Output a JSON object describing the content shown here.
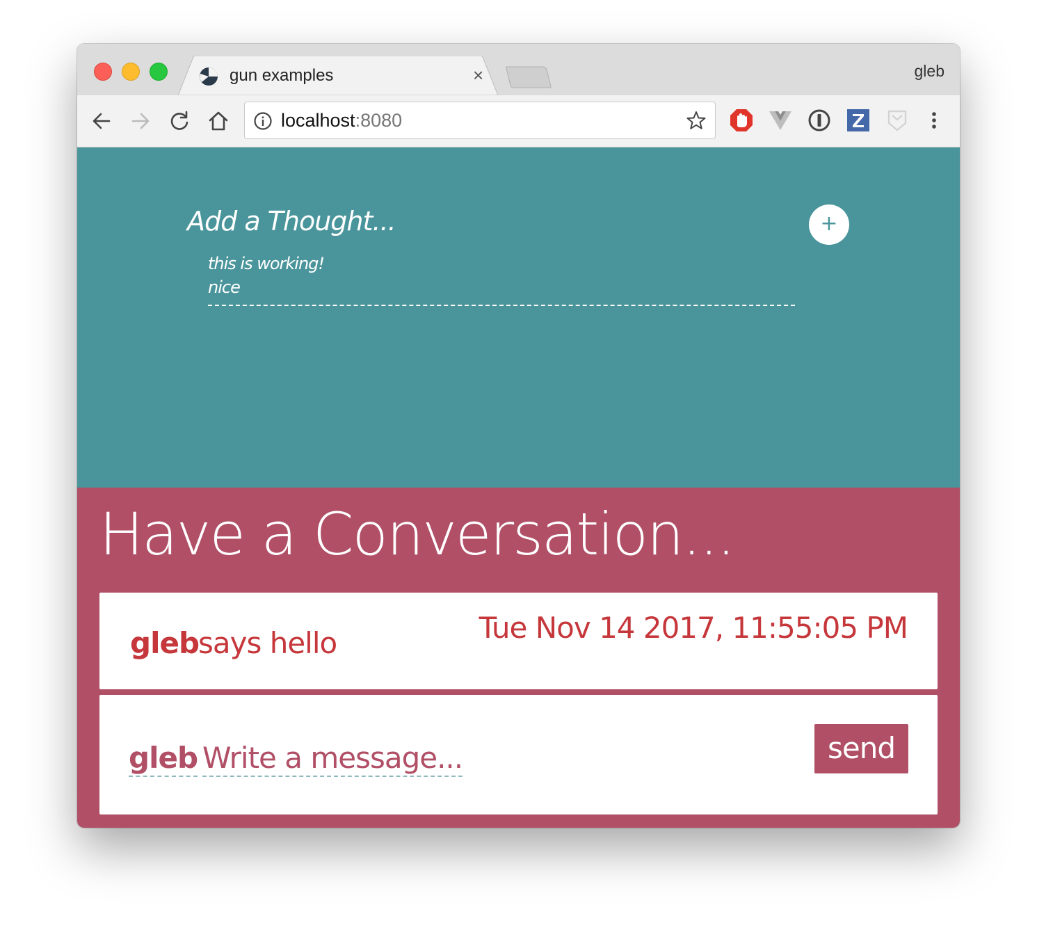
{
  "browser": {
    "tab_title": "gun examples",
    "tab_close_glyph": "×",
    "profile_name": "gleb",
    "url_host": "localhost",
    "url_port": ":8080",
    "icons": [
      "back-icon",
      "forward-icon",
      "reload-icon",
      "home-icon",
      "info-icon",
      "star-icon",
      "adblock-icon",
      "vue-devtools-icon",
      "1password-icon",
      "zotero-icon",
      "extension-icon",
      "menu-icon"
    ]
  },
  "thoughts": {
    "title": "Add a Thought...",
    "add_glyph": "+",
    "items": [
      "this is working!",
      "nice"
    ],
    "background": "#4a959b"
  },
  "conversation": {
    "title": "Have a Conversation...",
    "message": {
      "who": "gleb",
      "text": "says hello",
      "time": "Tue Nov 14 2017, 11:55:05 PM"
    },
    "compose": {
      "name": "gleb",
      "placeholder": "Write a message...",
      "send_label": "send"
    },
    "background": "#b04f66",
    "accent": "#c6373b"
  }
}
